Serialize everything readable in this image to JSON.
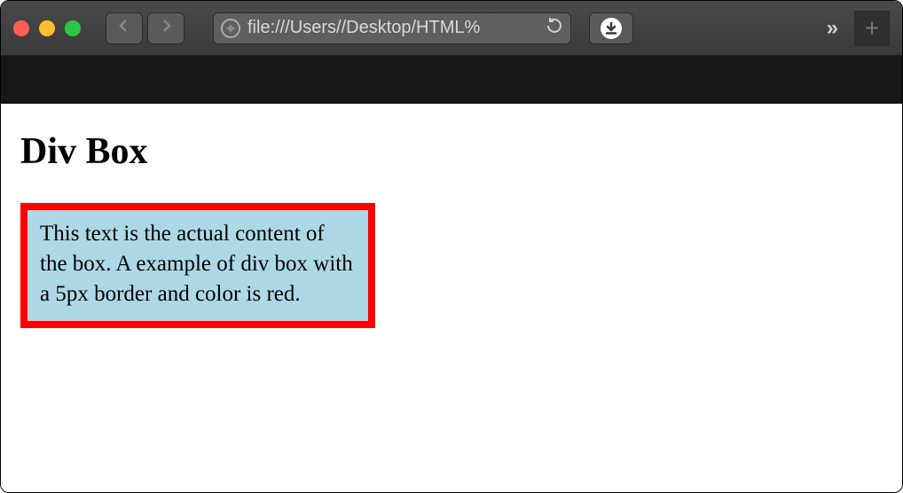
{
  "browser": {
    "url_display": "file:///Users//Desktop/HTML%",
    "overflow_symbol": "»",
    "newtab_symbol": "+"
  },
  "page": {
    "heading": "Div Box",
    "box_text": "This text is the actual content of the box. A example of div box with a 5px border and color is red."
  }
}
